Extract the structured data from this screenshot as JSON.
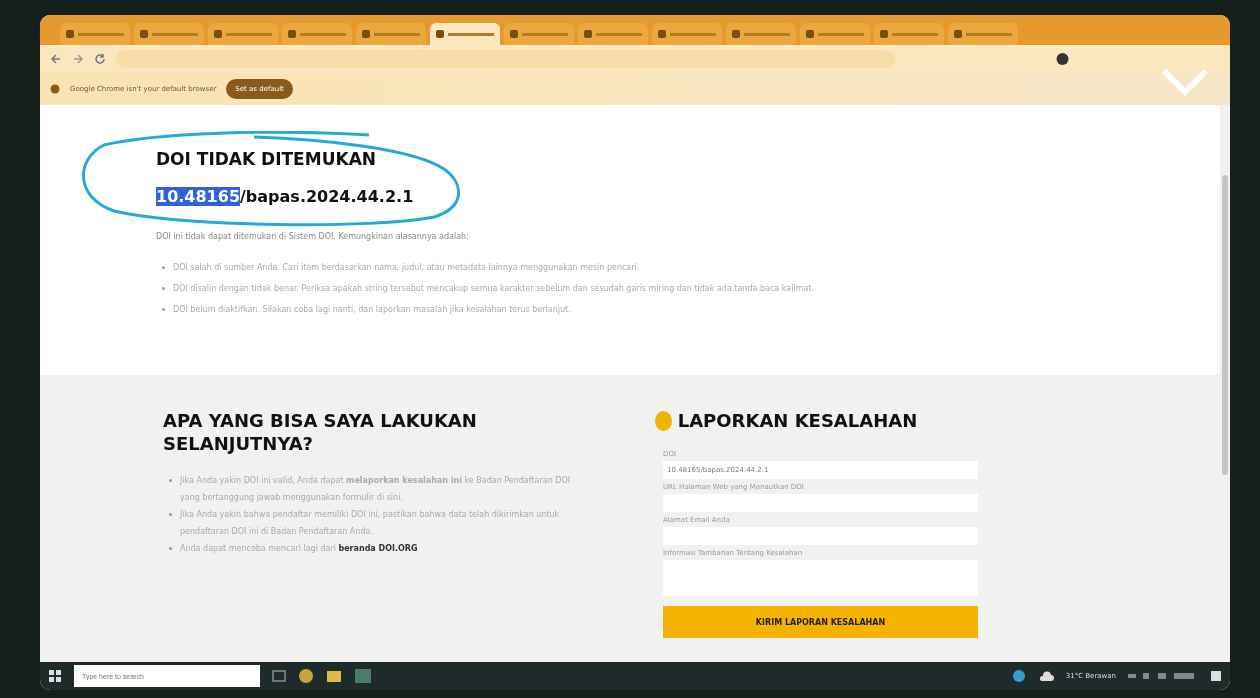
{
  "browser": {
    "tabs": [
      {
        "selected": false
      },
      {
        "selected": false
      },
      {
        "selected": false
      },
      {
        "selected": false
      },
      {
        "selected": false
      },
      {
        "selected": true
      },
      {
        "selected": false
      },
      {
        "selected": false
      },
      {
        "selected": false
      },
      {
        "selected": false
      },
      {
        "selected": false
      },
      {
        "selected": false
      },
      {
        "selected": false
      }
    ],
    "infobar": {
      "message": "Google Chrome isn't your default browser",
      "button": "Set as default"
    }
  },
  "not_found": {
    "title": "DOI TIDAK DITEMUKAN",
    "doi_highlighted": "10.48165",
    "doi_rest": "/bapas.2024.44.2.1",
    "intro": "DOI ini tidak dapat ditemukan di Sistem DOI. Kemungkinan alasannya adalah:",
    "reasons": [
      "DOI salah di sumber Anda. Cari item berdasarkan nama, judul, atau metadata lainnya menggunakan mesin pencari.",
      "DOI disalin dengan tidak benar. Periksa apakah string tersebut mencakup semua karakter sebelum dan sesudah garis miring dan tidak ada tanda baca kalimat.",
      "DOI belum diaktifkan. Silakan coba lagi nanti, dan laporkan masalah jika kesalahan terus berlanjut."
    ]
  },
  "next_steps": {
    "title": "APA YANG BISA SAYA LAKUKAN SELANJUTNYA?",
    "items": [
      {
        "text": "Jika Anda yakin DOI ini valid, Anda dapat **melaporkan kesalahan ini** ke Badan Pendaftaran DOI yang bertanggung jawab menggunakan formulir di sini."
      },
      {
        "text": "Jika Anda yakin bahwa pendaftar memiliki DOI ini, pastikan bahwa data telah dikirimkan untuk pendaftaran DOI ini di Badan Pendaftaran Anda."
      },
      {
        "text": "Anda dapat mencoba mencari lagi dari ",
        "link": "beranda DOI.ORG"
      }
    ]
  },
  "report": {
    "title": "LAPORKAN KESALAHAN",
    "fields": [
      {
        "label": "DOI",
        "value": "10.48165/bapas.2024.44.2.1",
        "kind": "input"
      },
      {
        "label": "URL Halaman Web yang Menautkan DOI",
        "kind": "input"
      },
      {
        "label": "Alamat Email Anda",
        "kind": "input"
      },
      {
        "label": "Informasi Tambahan Tentang Kesalahan",
        "kind": "textarea"
      }
    ],
    "submit": "KIRIM LAPORAN KESALAHAN"
  },
  "taskbar": {
    "search_placeholder": "Type here to search",
    "weather": "31°C Berawan"
  }
}
